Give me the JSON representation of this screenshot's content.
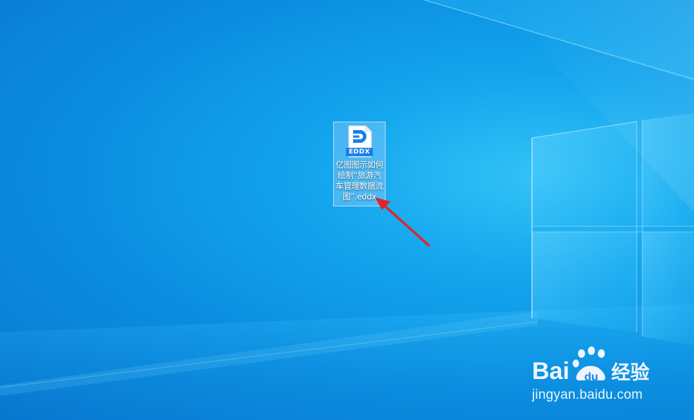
{
  "desktop": {
    "background_color": "#0b8ee0",
    "icons": [
      {
        "name": "亿图图示如何绘制“旅游汽车管理数据流图”.eddx",
        "badge": "EDDX",
        "icon": "eddx-file-icon",
        "badge_color": "#1a7fe6",
        "selected": true
      }
    ]
  },
  "annotation": {
    "icon": "red-arrow-icon",
    "color": "#e0252a"
  },
  "watermark": {
    "logo_text": "Bai百经验",
    "logo": "baidu-paw-icon",
    "url": "jingyan.baidu.com"
  }
}
